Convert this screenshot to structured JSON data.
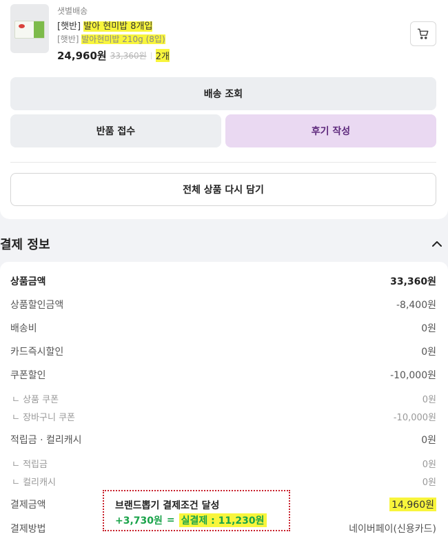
{
  "order": {
    "delivery_type": "샛별배송",
    "product_name_prefix": "[햇반] ",
    "product_name_hl": "발아 현미밥 8개입",
    "option_prefix": "[햇반] ",
    "option_hl": "발아현미밥 210g (8입)",
    "price": "24,960원",
    "original_price": "33,360원",
    "quantity": "2개",
    "cart_icon": "cart-icon"
  },
  "actions": {
    "track_delivery": "배송 조회",
    "return_request": "반품 접수",
    "write_review": "후기 작성",
    "recart_all": "전체 상품 다시 담기"
  },
  "payment": {
    "title": "결제 정보",
    "collapse_icon": "chevron-up-icon",
    "rows": {
      "product_amount": {
        "label": "상품금액",
        "value": "33,360원"
      },
      "product_discount": {
        "label": "상품할인금액",
        "value": "-8,400원"
      },
      "shipping": {
        "label": "배송비",
        "value": "0원"
      },
      "card_discount": {
        "label": "카드즉시할인",
        "value": "0원"
      },
      "coupon_discount": {
        "label": "쿠폰할인",
        "value": "-10,000원"
      },
      "product_coupon": {
        "label": "ㄴ 상품 쿠폰",
        "value": "0원"
      },
      "cart_coupon": {
        "label": "ㄴ 장바구니 쿠폰",
        "value": "-10,000원"
      },
      "points_cash": {
        "label": "적립금 · 컬리캐시",
        "value": "0원"
      },
      "points": {
        "label": "ㄴ 적립금",
        "value": "0원"
      },
      "kurly_cash": {
        "label": "ㄴ 컬리캐시",
        "value": "0원"
      },
      "total": {
        "label": "결제금액",
        "value": "14,960원"
      },
      "method": {
        "label": "결제방법",
        "value": "네이버페이(신용카드)"
      }
    }
  },
  "promo": {
    "line1": "브랜드뽑기 결제조건 달성",
    "bonus": "+3,730원",
    "equals": "=",
    "net": "실결제 : 11,230원"
  },
  "colors": {
    "highlight": "#f8f53c",
    "review_bg": "#ead9f2",
    "review_text": "#5f2b7e",
    "promo_border": "#c8202b",
    "promo_green": "#1aa34a"
  }
}
